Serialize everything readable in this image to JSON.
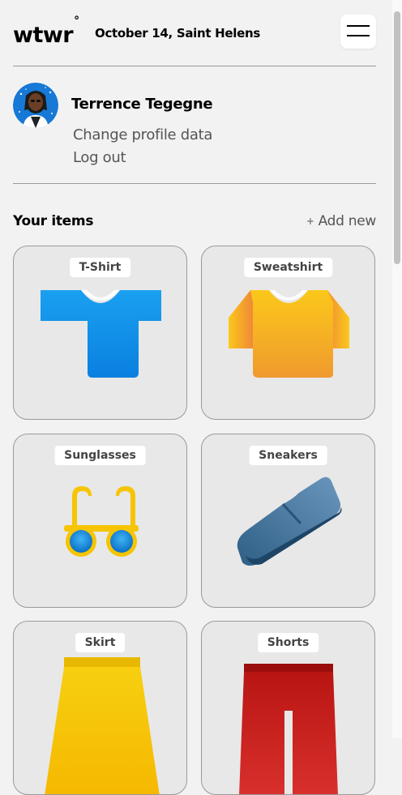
{
  "header": {
    "logo_text": "wtwr",
    "logo_mark": "°",
    "date_location": "October 14, Saint Helens",
    "menu_icon": "hamburger-menu-icon"
  },
  "profile": {
    "name": "Terrence Tegegne",
    "change_profile_label": "Change profile data",
    "logout_label": "Log out"
  },
  "items_section": {
    "title": "Your items",
    "add_new_label": "Add new",
    "add_icon": "+"
  },
  "items": [
    {
      "name": "T-Shirt",
      "color": "#1e9be8"
    },
    {
      "name": "Sweatshirt",
      "color": "#f2a22d"
    },
    {
      "name": "Sunglasses",
      "color": "#f6c400"
    },
    {
      "name": "Sneakers",
      "color": "#4a7aa3"
    },
    {
      "name": "Skirt",
      "color": "#f5c800"
    },
    {
      "name": "Shorts",
      "color": "#c0201d"
    }
  ]
}
